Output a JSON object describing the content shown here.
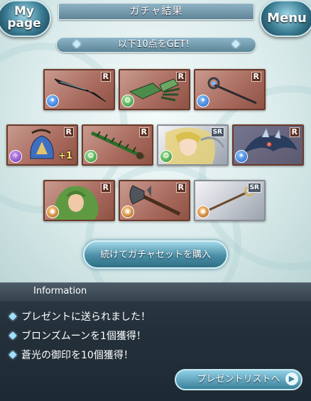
{
  "header": {
    "title": "ガチャ結果",
    "mypage_line1": "My",
    "mypage_line2": "page",
    "menu": "Menu"
  },
  "banner": {
    "text": "以下10点をGET！"
  },
  "results": [
    {
      "rarity": "R",
      "element": "water-icon",
      "item": "dagger"
    },
    {
      "rarity": "R",
      "element": "wind-icon",
      "item": "gauntlet"
    },
    {
      "rarity": "R",
      "element": "water-icon",
      "item": "staff"
    },
    {
      "rarity": "R",
      "element": "dark-icon",
      "item": "bell",
      "badge": "+1"
    },
    {
      "rarity": "R",
      "element": "wind-icon",
      "item": "thorn-sword"
    },
    {
      "rarity": "SR",
      "element": "wind-icon",
      "item": "summon-girl"
    },
    {
      "rarity": "R",
      "element": "water-icon",
      "item": "summon-beast"
    },
    {
      "rarity": "R",
      "element": "earth-icon",
      "item": "summon-dryad"
    },
    {
      "rarity": "R",
      "element": "earth-icon",
      "item": "axe"
    },
    {
      "rarity": "SR",
      "element": "earth-icon",
      "item": "scepter"
    }
  ],
  "buy_button": {
    "label": "続けてガチャセットを購入"
  },
  "info": {
    "heading": "Information",
    "messages": [
      "プレゼントに送られました！",
      "ブロンズムーンを1個獲得！",
      "蒼光の御印を10個獲得！"
    ],
    "present_button": "プレゼントリストへ"
  },
  "colors": {
    "card_r": "#a86a5d",
    "card_sr": "#c9cdd4",
    "accent": "#4a8ea5"
  }
}
